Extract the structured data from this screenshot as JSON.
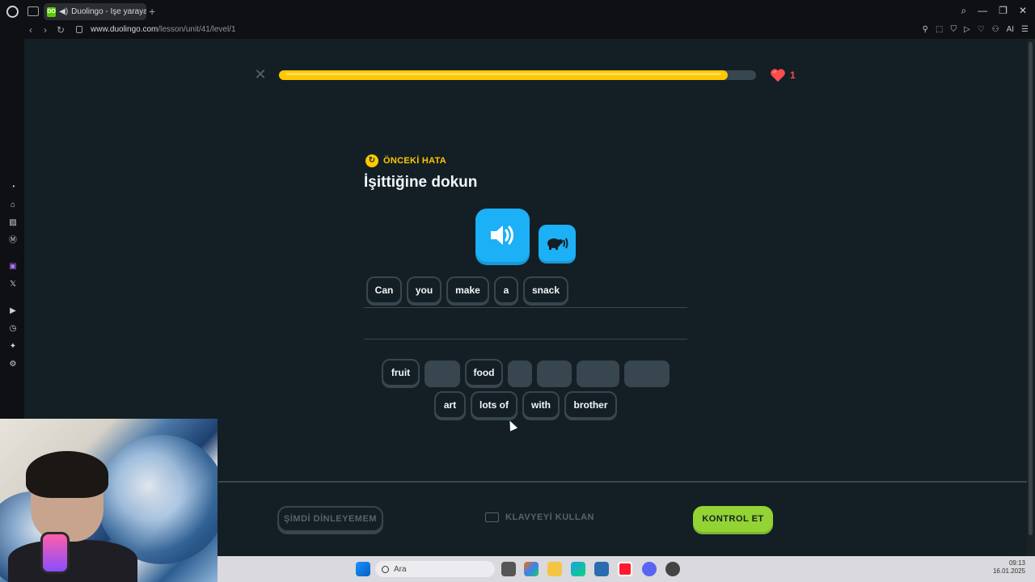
{
  "browser": {
    "tab_title": "Duolingo - İşe yarayan",
    "tab_favicon_text": "DO",
    "url_host": "www.duolingo.com",
    "url_path": "/lesson/unit/41/level/1",
    "ai_label": "AI"
  },
  "lesson": {
    "progress_fraction": 0.94,
    "hearts": "1",
    "badge": "ÖNCEKİ HATA",
    "title": "İşittiğine dokun",
    "answer_words": [
      "Can",
      "you",
      "make",
      "a",
      "snack"
    ],
    "bank_row1": [
      "fruit",
      "",
      "food",
      "",
      "",
      "",
      ""
    ],
    "bank_row2": [
      "art",
      "lots of",
      "with",
      "brother"
    ]
  },
  "footer": {
    "skip_label": "ŞİMDİ DİNLEYEMEM",
    "keyboard_label": "KLAVYEYİ KULLAN",
    "check_label": "KONTROL ET"
  },
  "taskbar": {
    "search_placeholder": "Ara",
    "time": "09:13",
    "date": "16.01.2025"
  },
  "colors": {
    "progress": "#ffc800",
    "check_button": "#93d333",
    "speaker": "#1cb0f6",
    "heart": "#ff4b4b"
  }
}
